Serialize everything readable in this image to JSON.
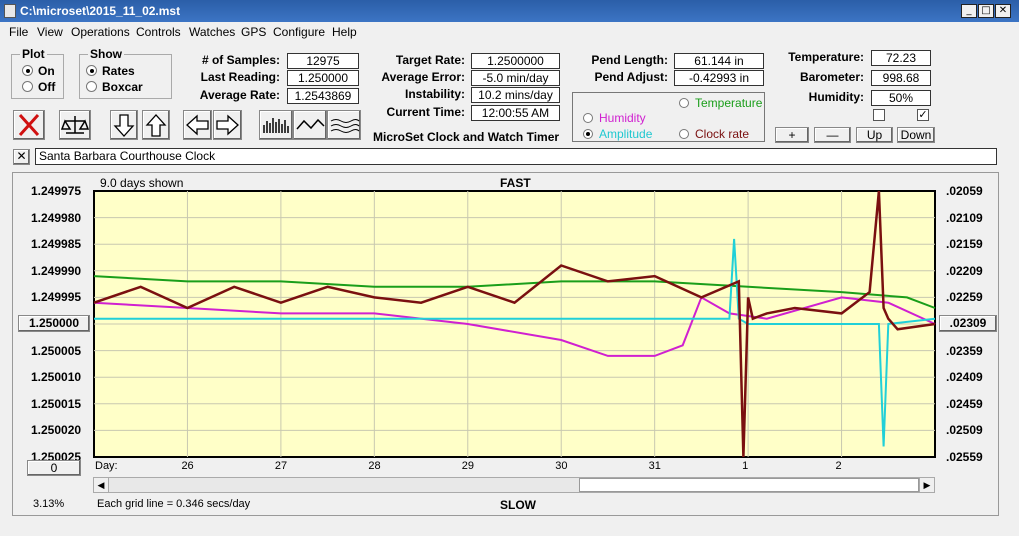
{
  "window": {
    "title": "C:\\microset\\2015_11_02.mst",
    "minimize": "_",
    "maximize": "□",
    "close": "✕"
  },
  "menu": [
    "File",
    "View",
    "Operations",
    "Controls",
    "Watches",
    "GPS",
    "Configure",
    "Help"
  ],
  "plot_group": {
    "title": "Plot",
    "options": [
      "On",
      "Off"
    ],
    "selected": "On"
  },
  "show_group": {
    "title": "Show",
    "options": [
      "Rates",
      "Boxcar"
    ],
    "selected": "Rates"
  },
  "stats": {
    "samples_label": "# of Samples:",
    "samples": "12975",
    "last_reading_label": "Last Reading:",
    "last_reading": "1.250000",
    "average_rate_label": "Average Rate:",
    "average_rate": "1.2543869",
    "target_rate_label": "Target Rate:",
    "target_rate": "1.2500000",
    "average_error_label": "Average Error:",
    "average_error": "-5.0 min/day",
    "instability_label": "Instability:",
    "instability": "10.2 mins/day",
    "current_time_label": "Current Time:",
    "current_time": "12:00:55 AM",
    "pend_length_label": "Pend Length:",
    "pend_length": "61.144 in",
    "pend_adjust_label": "Pend Adjust:",
    "pend_adjust": "-0.42993 in",
    "temperature_label": "Temperature:",
    "temperature": "72.23",
    "barometer_label": "Barometer:",
    "barometer": "998.68",
    "humidity_label": "Humidity:",
    "humidity": "50%"
  },
  "app_label": "MicroSet Clock and Watch Timer",
  "overlay_options": [
    {
      "label": "Temperature",
      "color": "#1a9e1a",
      "selected": false
    },
    {
      "label": "Humidity",
      "color": "#d020d0",
      "selected": false
    },
    {
      "label": "Amplitude",
      "color": "#20d0d8",
      "selected": true
    },
    {
      "label": "Clock rate",
      "color": "#7a1010",
      "selected": false
    }
  ],
  "scale_buttons": {
    "plus": "+",
    "minus": "—",
    "up": "Up",
    "down": "Down"
  },
  "checkboxes": {
    "left": "",
    "right": "✓"
  },
  "clock_close": "✕",
  "clock_name": "Santa Barbara Courthouse Clock",
  "chart_data": {
    "type": "line",
    "header_left": "9.0 days shown",
    "header_center": "FAST",
    "footer_center": "SLOW",
    "footer_left_pct": "3.13%",
    "footer_grid_note": "Each grid line = 0.346 secs/day",
    "left_button": "1.250000",
    "right_button": ".02309",
    "bottom_left_button": "0",
    "x_axis_prefix": "Day:",
    "x_labels": [
      "26",
      "27",
      "28",
      "29",
      "30",
      "31",
      "1",
      "2"
    ],
    "y_left_labels": [
      "1.249975",
      "1.249980",
      "1.249985",
      "1.249990",
      "1.249995",
      "1.250005",
      "1.250010",
      "1.250015",
      "1.250020",
      "1.250025"
    ],
    "y_right_labels": [
      ".02059",
      ".02109",
      ".02159",
      ".02209",
      ".02259",
      ".02359",
      ".02409",
      ".02459",
      ".02509",
      ".02559"
    ],
    "ylim": [
      1.249975,
      1.250025
    ],
    "series": [
      {
        "name": "Clock rate",
        "color": "#7a1010",
        "x": [
          0,
          0.5,
          1,
          1.5,
          2,
          2.5,
          3,
          3.5,
          4,
          4.5,
          5,
          5.5,
          6,
          6.5,
          6.9,
          6.95,
          7.0,
          7.05,
          7.2,
          7.5,
          8,
          8.3,
          8.4,
          8.45,
          8.5,
          8.6,
          9
        ],
        "values": [
          1.249996,
          1.249993,
          1.249997,
          1.249993,
          1.249996,
          1.249993,
          1.249995,
          1.249996,
          1.249993,
          1.249996,
          1.249989,
          1.249992,
          1.249991,
          1.249995,
          1.249992,
          1.250025,
          1.249995,
          1.249999,
          1.249998,
          1.249997,
          1.249998,
          1.249994,
          1.249975,
          1.249997,
          1.249999,
          1.250001,
          1.25
        ]
      },
      {
        "name": "Temperature",
        "color": "#1a9e1a",
        "x": [
          0,
          1,
          2,
          3,
          4,
          5,
          6,
          7,
          8,
          8.7,
          9
        ],
        "values": [
          1.249991,
          1.249992,
          1.249992,
          1.249993,
          1.249993,
          1.249992,
          1.249992,
          1.249993,
          1.249994,
          1.249995,
          1.249997
        ]
      },
      {
        "name": "Humidity",
        "color": "#d020d0",
        "x": [
          0,
          1,
          2,
          3,
          4,
          5,
          5.5,
          6,
          6.3,
          6.5,
          6.8,
          7.2,
          8,
          8.5,
          9
        ],
        "values": [
          1.249996,
          1.249997,
          1.249998,
          1.249998,
          1.25,
          1.250003,
          1.250006,
          1.250006,
          1.250004,
          1.249995,
          1.249998,
          1.249999,
          1.249995,
          1.249996,
          1.25
        ]
      },
      {
        "name": "Amplitude",
        "color": "#20d0d8",
        "x": [
          0,
          2,
          4,
          6,
          6.8,
          6.85,
          6.9,
          7.0,
          8,
          8.4,
          8.45,
          8.5,
          9
        ],
        "values": [
          1.249999,
          1.249999,
          1.249999,
          1.249999,
          1.249999,
          1.249984,
          1.249999,
          1.25,
          1.25,
          1.25,
          1.250023,
          1.25,
          1.249999
        ]
      }
    ]
  }
}
